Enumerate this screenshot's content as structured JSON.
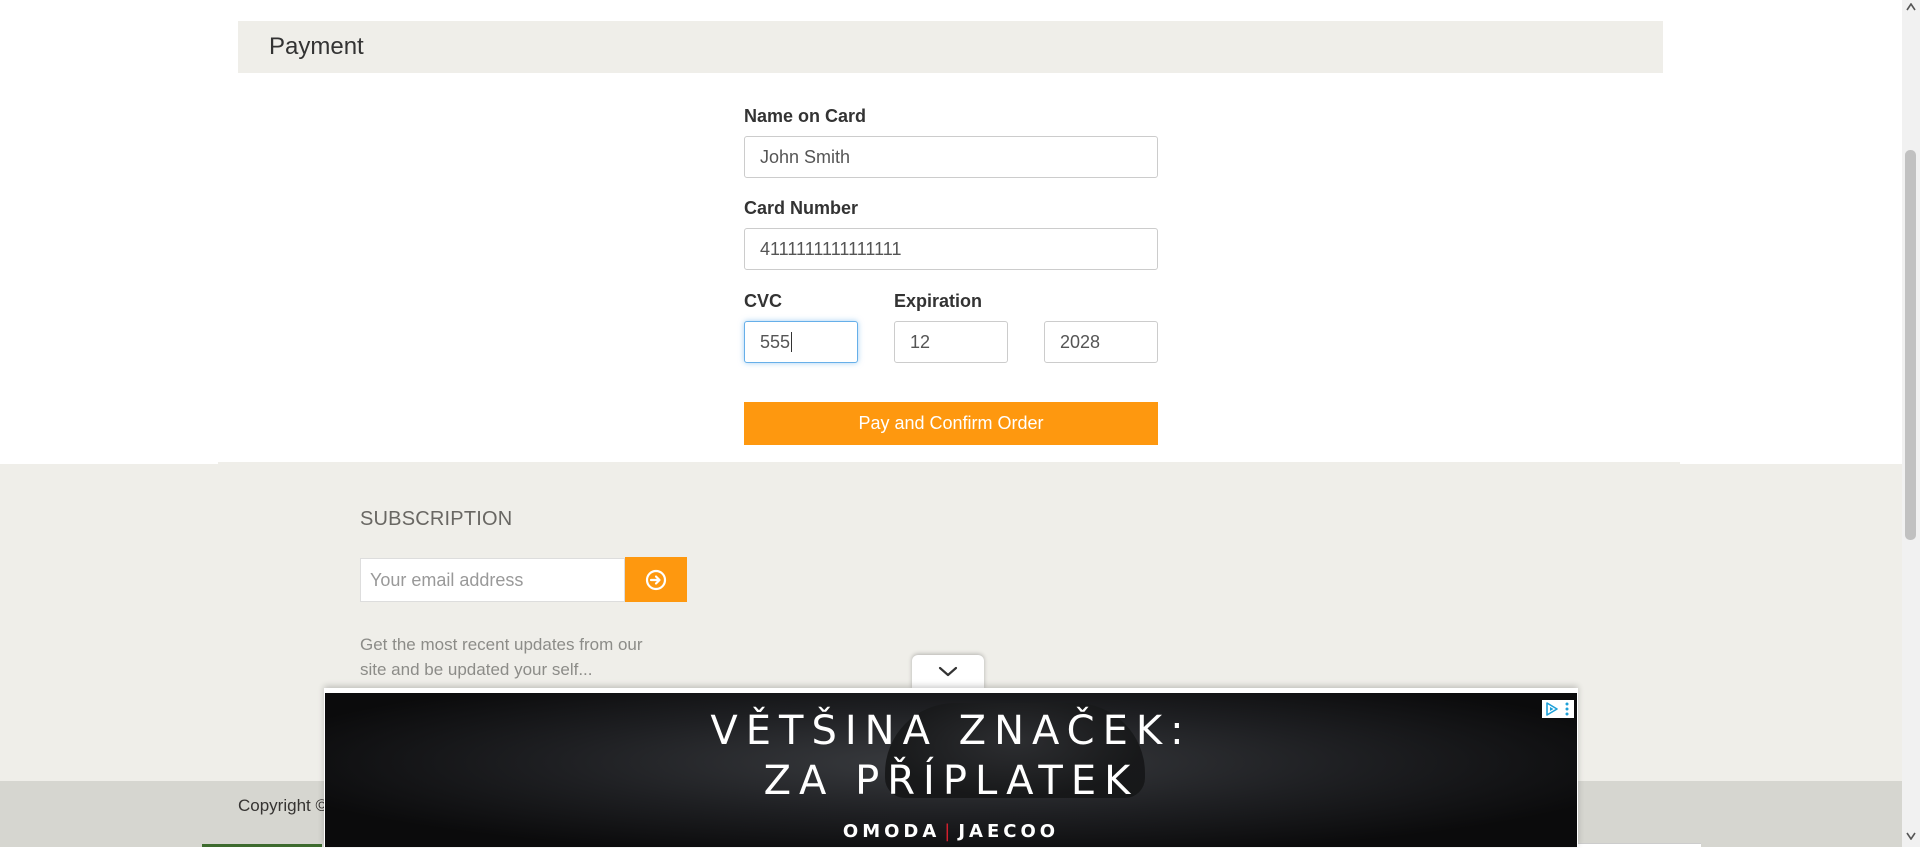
{
  "payment": {
    "title": "Payment",
    "name_label": "Name on Card",
    "name_value": "John Smith",
    "card_label": "Card Number",
    "card_value": "4111111111111111",
    "cvc_label": "CVC",
    "cvc_value": "555",
    "expiration_label": "Expiration",
    "exp_month_value": "12",
    "exp_year_value": "2028",
    "pay_button_label": "Pay and Confirm Order"
  },
  "subscription": {
    "title": "SUBSCRIPTION",
    "email_placeholder": "Your email address",
    "button_icon": "arrow-circle-right-icon",
    "description": "Get the most recent updates from our site and be updated your self..."
  },
  "footer": {
    "copyright": "Copyright ©"
  },
  "ad": {
    "line1": "VĚTŠINA ZNAČEK:",
    "line2": "ZA PŘÍPLATEK",
    "brand_left": "OMODA",
    "brand_separator": "|",
    "brand_right": "JAECOO",
    "collapse_icon": "chevron-down-icon",
    "adchoices_icon": "adchoices-icon",
    "menu_icon": "kebab-menu-icon"
  },
  "colors": {
    "accent": "#fe980f",
    "panel_bg": "#efeee9",
    "footer_bottom_bg": "#d6d6d0",
    "focus_border": "#66afe9"
  }
}
